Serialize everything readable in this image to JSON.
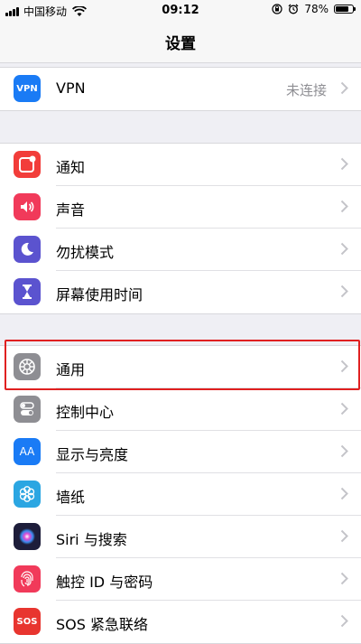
{
  "status_bar": {
    "carrier": "中国移动",
    "time": "09:12",
    "battery_text": "78%",
    "battery_level": 0.78
  },
  "nav": {
    "title": "设置"
  },
  "groups": [
    {
      "rows": [
        {
          "label": "VPN",
          "value": "未连接",
          "icon": "vpn-icon",
          "icon_text": "VPN",
          "color": "#1a7bf5"
        }
      ]
    },
    {
      "rows": [
        {
          "label": "通知",
          "icon": "notifications-icon",
          "color": "#f23d3a"
        },
        {
          "label": "声音",
          "icon": "sound-icon",
          "color": "#f13a5a"
        },
        {
          "label": "勿扰模式",
          "icon": "moon-icon",
          "color": "#5b53cf"
        },
        {
          "label": "屏幕使用时间",
          "icon": "hourglass-icon",
          "color": "#5b53cf"
        }
      ]
    },
    {
      "rows": [
        {
          "label": "通用",
          "icon": "gear-icon",
          "color": "#8e8e93"
        },
        {
          "label": "控制中心",
          "icon": "toggle-icon",
          "color": "#8e8e93"
        },
        {
          "label": "显示与亮度",
          "icon": "text-size-icon",
          "icon_text": "AA",
          "color": "#1a7bf5"
        },
        {
          "label": "墙纸",
          "icon": "wallpaper-flower-icon",
          "color": "#2ba6e2"
        },
        {
          "label": "Siri 与搜索",
          "icon": "siri-icon",
          "color": "#1d1d3a"
        },
        {
          "label": "触控 ID 与密码",
          "icon": "fingerprint-icon",
          "color": "#f13a5a"
        },
        {
          "label": "SOS 紧急联络",
          "icon": "sos-icon",
          "icon_text": "SOS",
          "color": "#e8352f"
        }
      ]
    }
  ],
  "highlight_color": "#e02020"
}
